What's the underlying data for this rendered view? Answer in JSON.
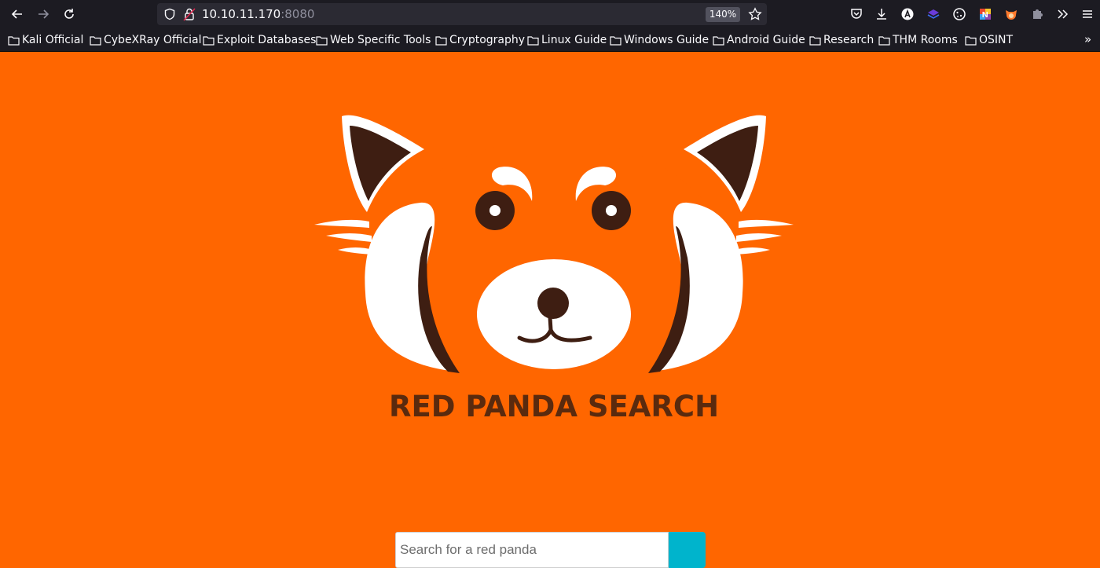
{
  "browser": {
    "url_host": "10.10.11.170",
    "url_port": ":8080",
    "zoom": "140%",
    "icons": {
      "back": "arrow-left-icon",
      "forward": "arrow-right-icon",
      "reload": "reload-icon",
      "shield": "shield-icon",
      "lock": "insecure-lock-icon",
      "star": "star-icon",
      "pocket": "pocket-icon",
      "download": "download-icon",
      "menu": "hamburger-menu-icon"
    }
  },
  "bookmarks": [
    {
      "label": "Kali Official"
    },
    {
      "label": "CybeXRay Official"
    },
    {
      "label": "Exploit Databases"
    },
    {
      "label": "Web Specific Tools"
    },
    {
      "label": "Cryptography"
    },
    {
      "label": "Linux Guide"
    },
    {
      "label": "Windows Guide"
    },
    {
      "label": "Android Guide"
    },
    {
      "label": "Research"
    },
    {
      "label": "THM Rooms"
    },
    {
      "label": "OSINT"
    }
  ],
  "bookmarks_overflow": "»",
  "page": {
    "title": "RED PANDA SEARCH",
    "search_placeholder": "Search for a red panda",
    "colors": {
      "background": "#ff6600",
      "title": "#5a2a0e",
      "search_button": "#00b4cc"
    }
  }
}
